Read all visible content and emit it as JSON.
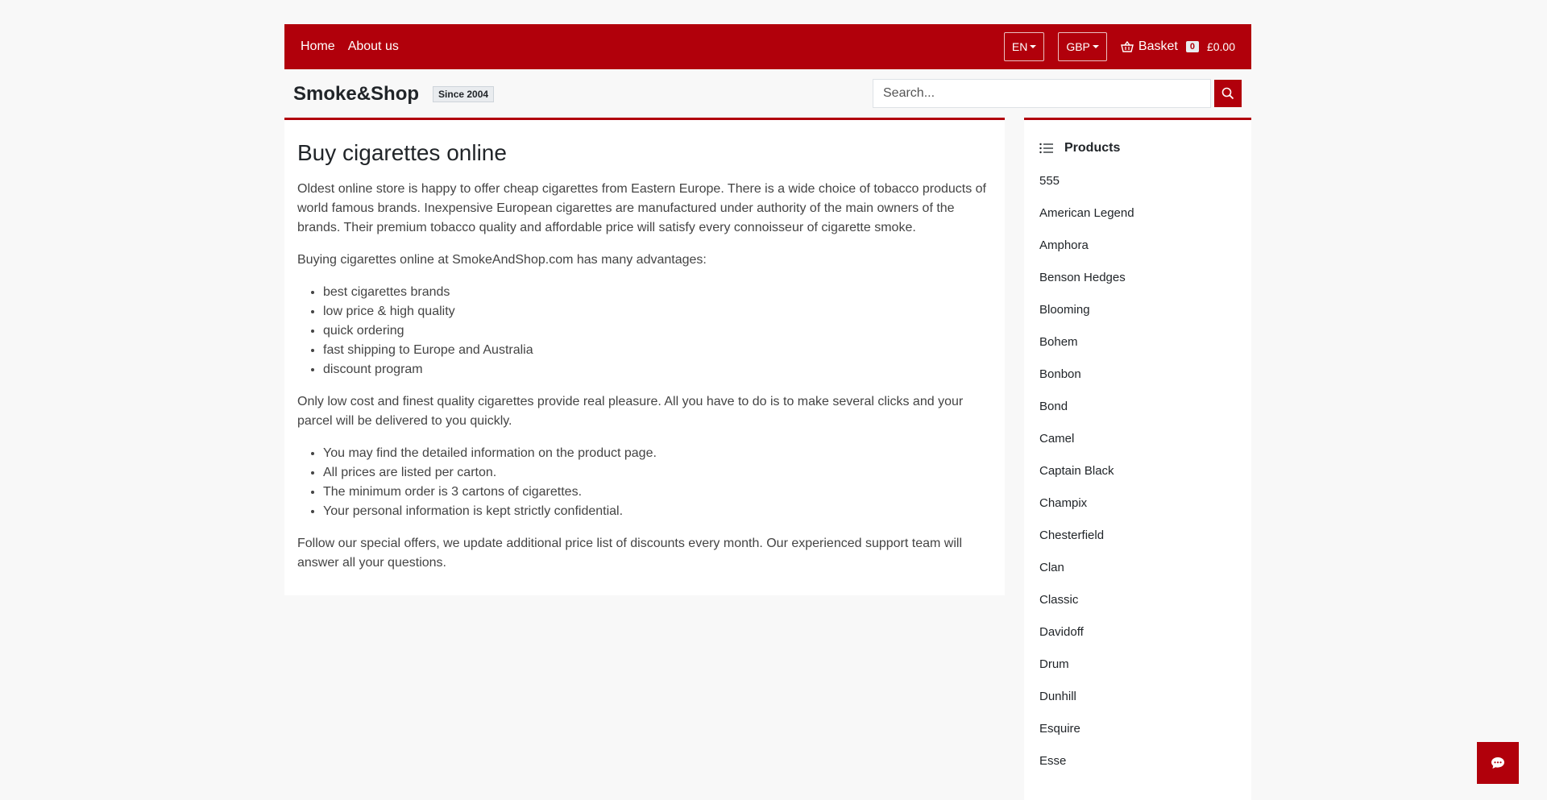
{
  "nav": {
    "links": [
      "Home",
      "About us"
    ],
    "language": "EN",
    "currency": "GBP",
    "basket_label": "Basket",
    "basket_count": "0",
    "basket_total": "£0.00"
  },
  "brand": {
    "name": "Smoke&Shop",
    "since": "Since 2004"
  },
  "search": {
    "placeholder": "Search..."
  },
  "main": {
    "title": "Buy cigarettes online",
    "intro": "Oldest online store is happy to offer cheap cigarettes from Eastern Europe. There is a wide choice of tobacco products of world famous brands. Inexpensive European cigarettes are manufactured under authority of the main owners of the brands. Their premium tobacco quality and affordable price will satisfy every connoisseur of cigarette smoke.",
    "advantages_intro": "Buying cigarettes online at SmokeAndShop.com has many advantages:",
    "advantages": [
      "best cigarettes brands",
      "low price & high quality",
      "quick ordering",
      "fast shipping to Europe and Australia",
      "discount program"
    ],
    "pleasure": "Only low cost and finest quality cigarettes provide real pleasure. All you have to do is to make several clicks and your parcel will be delivered to you quickly.",
    "info": [
      "You may find the detailed information on the product page.",
      "All prices are listed per carton.",
      "The minimum order is 3 cartons of cigarettes.",
      "Your personal information is kept strictly confidential."
    ],
    "closing": "Follow our special offers, we update additional price list of discounts every month. Our experienced support team will answer all your questions."
  },
  "sidebar": {
    "title": "Products",
    "products": [
      "555",
      "American Legend",
      "Amphora",
      "Benson Hedges",
      "Blooming",
      "Bohem",
      "Bonbon",
      "Bond",
      "Camel",
      "Captain Black",
      "Champix",
      "Chesterfield",
      "Clan",
      "Classic",
      "Davidoff",
      "Drum",
      "Dunhill",
      "Esquire",
      "Esse"
    ]
  },
  "colors": {
    "brand_red": "#b1000b"
  },
  "icons": [
    "basket-icon",
    "search-icon",
    "list-icon",
    "chat-icon"
  ]
}
